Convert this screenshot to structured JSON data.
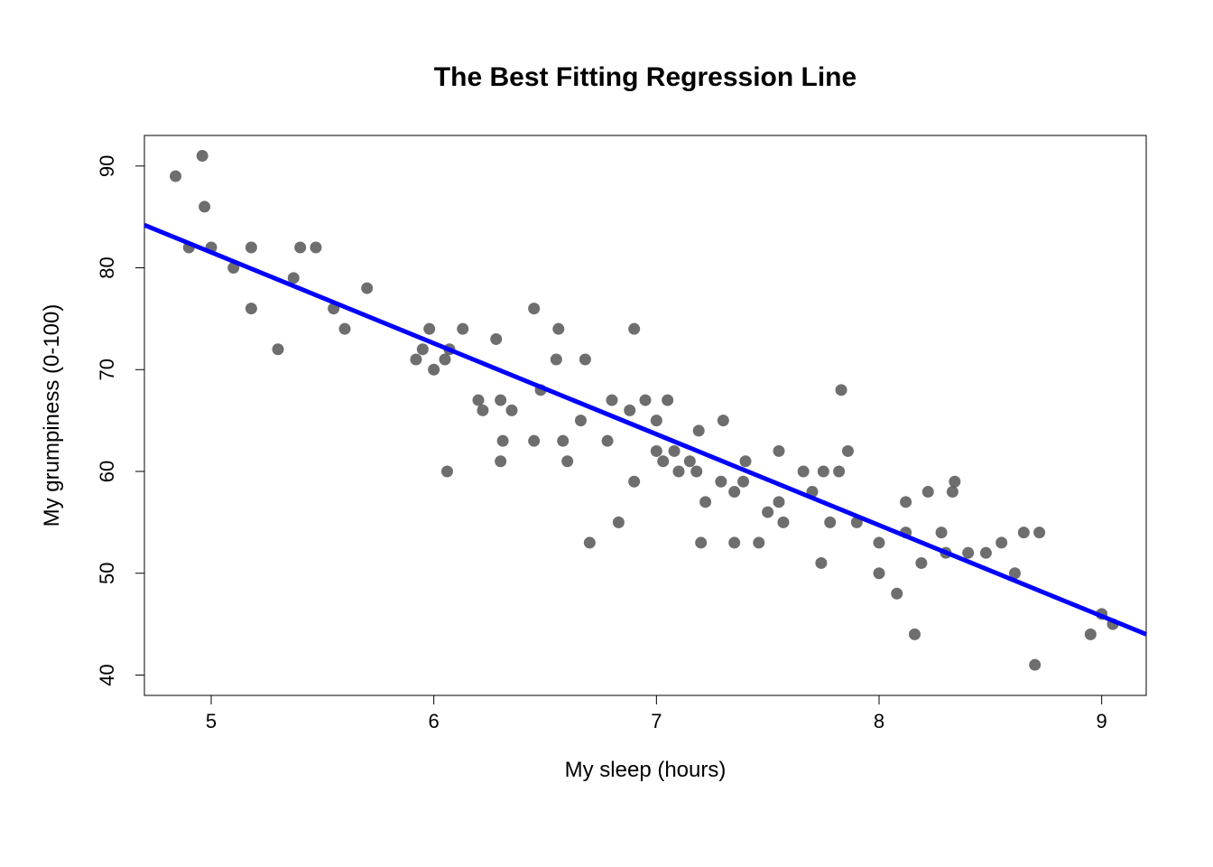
{
  "chart_data": {
    "type": "scatter",
    "title": "The Best Fitting Regression Line",
    "xlabel": "My sleep (hours)",
    "ylabel": "My grumpiness (0-100)",
    "xlim": [
      4.7,
      9.2
    ],
    "ylim": [
      38,
      93
    ],
    "x_ticks": [
      5,
      6,
      7,
      8,
      9
    ],
    "y_ticks": [
      40,
      50,
      60,
      70,
      80,
      90
    ],
    "regression": {
      "x1": 4.7,
      "y1": 84.2,
      "x2": 9.2,
      "y2": 44.0
    },
    "points": [
      {
        "x": 4.84,
        "y": 89
      },
      {
        "x": 4.9,
        "y": 82
      },
      {
        "x": 4.96,
        "y": 91
      },
      {
        "x": 4.97,
        "y": 86
      },
      {
        "x": 5.0,
        "y": 82
      },
      {
        "x": 5.1,
        "y": 80
      },
      {
        "x": 5.18,
        "y": 82
      },
      {
        "x": 5.18,
        "y": 76
      },
      {
        "x": 5.3,
        "y": 72
      },
      {
        "x": 5.37,
        "y": 79
      },
      {
        "x": 5.4,
        "y": 82
      },
      {
        "x": 5.47,
        "y": 82
      },
      {
        "x": 5.55,
        "y": 76
      },
      {
        "x": 5.6,
        "y": 74
      },
      {
        "x": 5.7,
        "y": 78
      },
      {
        "x": 5.92,
        "y": 71
      },
      {
        "x": 5.95,
        "y": 72
      },
      {
        "x": 5.98,
        "y": 74
      },
      {
        "x": 6.0,
        "y": 70
      },
      {
        "x": 6.05,
        "y": 71
      },
      {
        "x": 6.06,
        "y": 60
      },
      {
        "x": 6.07,
        "y": 72
      },
      {
        "x": 6.13,
        "y": 74
      },
      {
        "x": 6.2,
        "y": 67
      },
      {
        "x": 6.22,
        "y": 66
      },
      {
        "x": 6.28,
        "y": 73
      },
      {
        "x": 6.3,
        "y": 67
      },
      {
        "x": 6.3,
        "y": 61
      },
      {
        "x": 6.31,
        "y": 63
      },
      {
        "x": 6.35,
        "y": 66
      },
      {
        "x": 6.45,
        "y": 63
      },
      {
        "x": 6.45,
        "y": 76
      },
      {
        "x": 6.48,
        "y": 68
      },
      {
        "x": 6.55,
        "y": 71
      },
      {
        "x": 6.56,
        "y": 74
      },
      {
        "x": 6.58,
        "y": 63
      },
      {
        "x": 6.6,
        "y": 61
      },
      {
        "x": 6.66,
        "y": 65
      },
      {
        "x": 6.68,
        "y": 71
      },
      {
        "x": 6.7,
        "y": 53
      },
      {
        "x": 6.78,
        "y": 63
      },
      {
        "x": 6.8,
        "y": 67
      },
      {
        "x": 6.83,
        "y": 55
      },
      {
        "x": 6.88,
        "y": 66
      },
      {
        "x": 6.9,
        "y": 74
      },
      {
        "x": 6.9,
        "y": 59
      },
      {
        "x": 6.95,
        "y": 67
      },
      {
        "x": 7.0,
        "y": 62
      },
      {
        "x": 7.0,
        "y": 65
      },
      {
        "x": 7.03,
        "y": 61
      },
      {
        "x": 7.05,
        "y": 67
      },
      {
        "x": 7.08,
        "y": 62
      },
      {
        "x": 7.1,
        "y": 60
      },
      {
        "x": 7.15,
        "y": 61
      },
      {
        "x": 7.18,
        "y": 60
      },
      {
        "x": 7.19,
        "y": 64
      },
      {
        "x": 7.2,
        "y": 53
      },
      {
        "x": 7.22,
        "y": 57
      },
      {
        "x": 7.29,
        "y": 59
      },
      {
        "x": 7.3,
        "y": 65
      },
      {
        "x": 7.35,
        "y": 58
      },
      {
        "x": 7.35,
        "y": 53
      },
      {
        "x": 7.39,
        "y": 59
      },
      {
        "x": 7.4,
        "y": 61
      },
      {
        "x": 7.46,
        "y": 53
      },
      {
        "x": 7.5,
        "y": 56
      },
      {
        "x": 7.55,
        "y": 62
      },
      {
        "x": 7.55,
        "y": 57
      },
      {
        "x": 7.57,
        "y": 55
      },
      {
        "x": 7.66,
        "y": 60
      },
      {
        "x": 7.7,
        "y": 58
      },
      {
        "x": 7.74,
        "y": 51
      },
      {
        "x": 7.75,
        "y": 60
      },
      {
        "x": 7.78,
        "y": 55
      },
      {
        "x": 7.82,
        "y": 60
      },
      {
        "x": 7.83,
        "y": 68
      },
      {
        "x": 7.86,
        "y": 62
      },
      {
        "x": 7.9,
        "y": 55
      },
      {
        "x": 8.0,
        "y": 50
      },
      {
        "x": 8.0,
        "y": 53
      },
      {
        "x": 8.08,
        "y": 48
      },
      {
        "x": 8.12,
        "y": 57
      },
      {
        "x": 8.12,
        "y": 54
      },
      {
        "x": 8.16,
        "y": 44
      },
      {
        "x": 8.19,
        "y": 51
      },
      {
        "x": 8.22,
        "y": 58
      },
      {
        "x": 8.28,
        "y": 54
      },
      {
        "x": 8.3,
        "y": 52
      },
      {
        "x": 8.33,
        "y": 58
      },
      {
        "x": 8.34,
        "y": 59
      },
      {
        "x": 8.4,
        "y": 52
      },
      {
        "x": 8.48,
        "y": 52
      },
      {
        "x": 8.55,
        "y": 53
      },
      {
        "x": 8.61,
        "y": 50
      },
      {
        "x": 8.65,
        "y": 54
      },
      {
        "x": 8.7,
        "y": 41
      },
      {
        "x": 8.72,
        "y": 54
      },
      {
        "x": 8.95,
        "y": 44
      },
      {
        "x": 9.0,
        "y": 46
      },
      {
        "x": 9.05,
        "y": 45
      }
    ]
  }
}
